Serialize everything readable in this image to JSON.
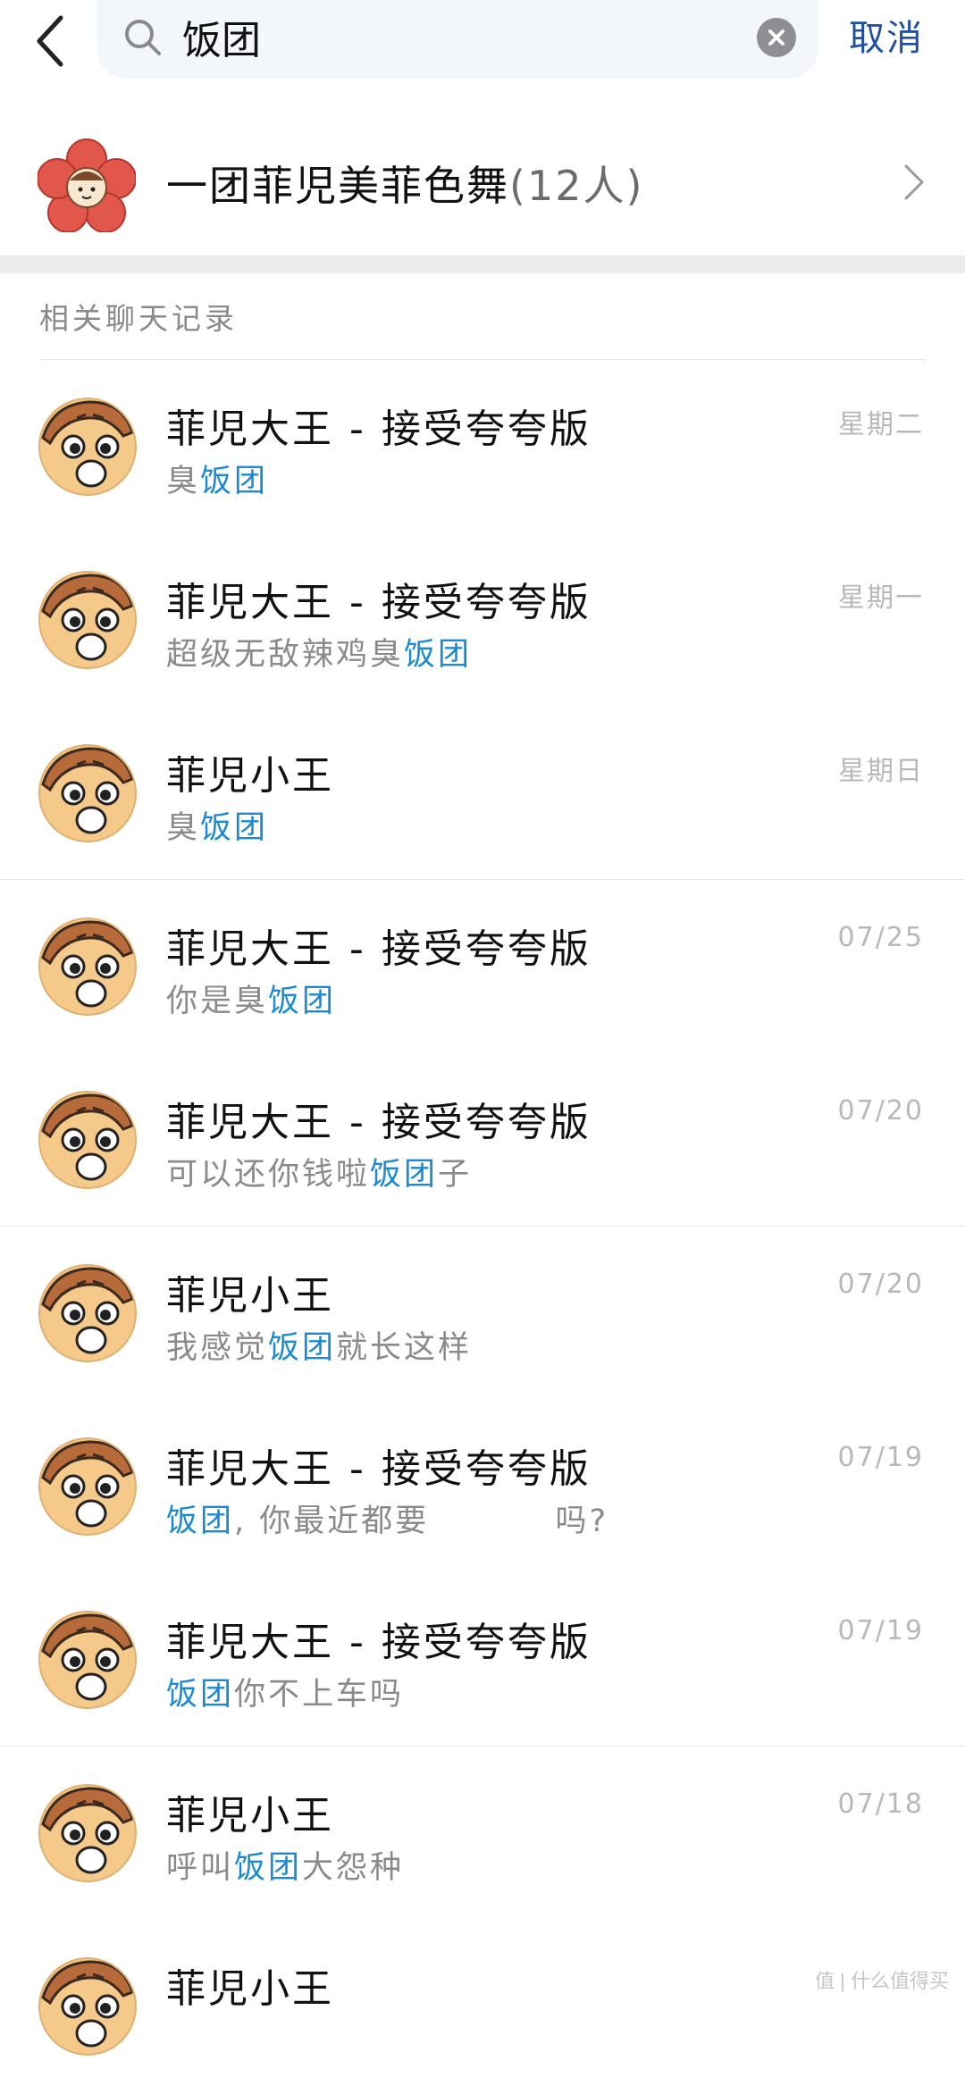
{
  "search": {
    "value": "饭团",
    "cancel_label": "取消"
  },
  "group": {
    "name": "一团菲児美菲色舞",
    "count": "(12人)"
  },
  "section": {
    "title": "相关聊天记录"
  },
  "highlight_color": "#1c8ad2",
  "icons": [
    "back-arrow-icon",
    "search-icon",
    "clear-icon",
    "chevron-right-icon"
  ],
  "chats": [
    {
      "name": "菲児大王 - 接受夸夸版",
      "time": "星期二",
      "pre": "臭",
      "hl": "饭团",
      "post": ""
    },
    {
      "name": "菲児大王 - 接受夸夸版",
      "time": "星期一",
      "pre": "超级无敌辣鸡臭",
      "hl": "饭团",
      "post": ""
    },
    {
      "name": "菲児小王",
      "time": "星期日",
      "pre": "臭",
      "hl": "饭团",
      "post": ""
    },
    {
      "name": "菲児大王 - 接受夸夸版",
      "time": "07/25",
      "pre": "你是臭",
      "hl": "饭团",
      "post": ""
    },
    {
      "name": "菲児大王 - 接受夸夸版",
      "time": "07/20",
      "pre": "可以还你钱啦",
      "hl": "饭团",
      "post": "子"
    },
    {
      "name": "菲児小王",
      "time": "07/20",
      "pre": "我感觉",
      "hl": "饭团",
      "post": "就长这样"
    },
    {
      "name": "菲児大王 - 接受夸夸版",
      "time": "07/19",
      "pre": "",
      "hl": "饭团",
      "post": ", 你最近都要          吗?"
    },
    {
      "name": "菲児大王 - 接受夸夸版",
      "time": "07/19",
      "pre": "",
      "hl": "饭团",
      "post": "你不上车吗"
    },
    {
      "name": "菲児小王",
      "time": "07/18",
      "pre": "呼叫",
      "hl": "饭团",
      "post": "大怨种"
    },
    {
      "name": "菲児小王",
      "time": "",
      "pre": "",
      "hl": "",
      "post": ""
    }
  ],
  "watermark": "值 | 什么值得买"
}
